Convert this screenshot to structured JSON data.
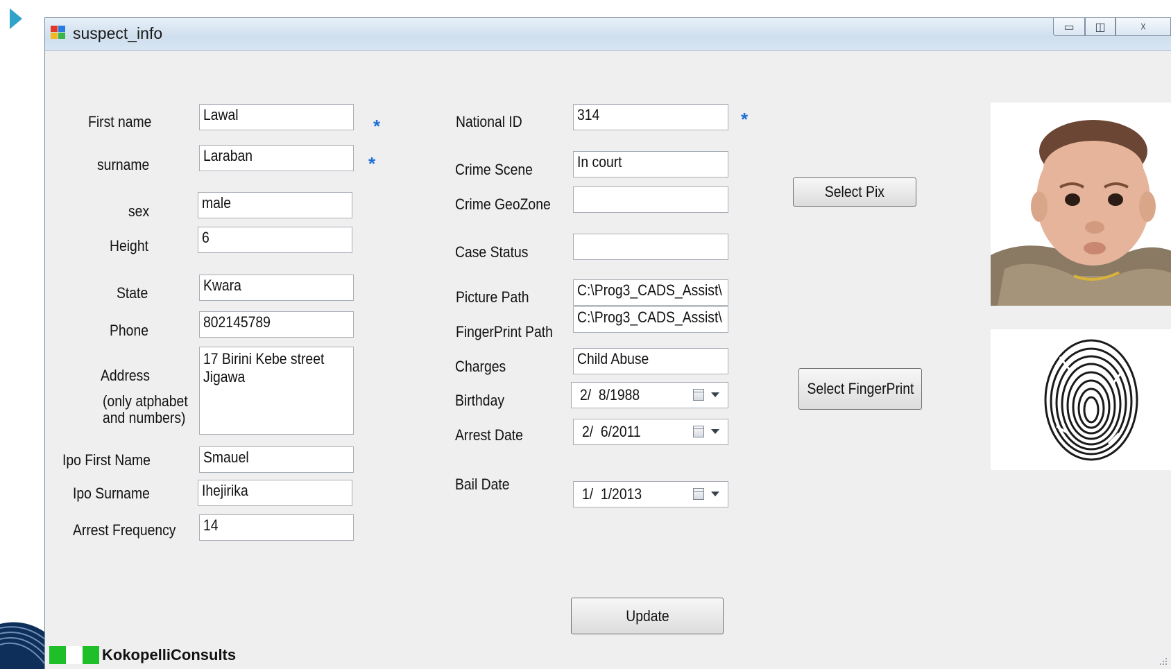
{
  "window": {
    "title": "suspect_info",
    "controls": {
      "minimize": "▭",
      "maximize": "◫",
      "close": "☓"
    }
  },
  "form": {
    "left": [
      {
        "label": "First name",
        "value": "Lawal"
      },
      {
        "label": "surname",
        "value": "Laraban"
      },
      {
        "label": "sex",
        "value": "male"
      },
      {
        "label": "Height",
        "value": "6"
      },
      {
        "label": "State",
        "value": "Kwara"
      },
      {
        "label": "Phone",
        "value": "802145789"
      },
      {
        "label": "Address",
        "hint_line1": "(only atphabet",
        "hint_line2": "and numbers)",
        "value": "17 Birini Kebe street Jigawa"
      },
      {
        "label": "Ipo First Name",
        "value": "Smauel"
      },
      {
        "label": "Ipo Surname",
        "value": "Ihejirika"
      },
      {
        "label": "Arrest Frequency",
        "value": "14"
      }
    ],
    "middle": [
      {
        "label": "National ID",
        "value": "314"
      },
      {
        "label": "Crime Scene",
        "value": "In court"
      },
      {
        "label": "Crime GeoZone",
        "value": ""
      },
      {
        "label": "Case Status",
        "value": ""
      },
      {
        "label": "Picture Path",
        "value": "C:\\Prog3_CADS_Assist\\"
      },
      {
        "label": "FingerPrint Path",
        "value": "C:\\Prog3_CADS_Assist\\"
      },
      {
        "label": "Charges",
        "value": "Child Abuse"
      },
      {
        "label": "Birthday",
        "value": "2/  8/1988"
      },
      {
        "label": "Arrest Date",
        "value": "2/  6/2011"
      },
      {
        "label": "Bail Date",
        "value": "1/  1/2013"
      }
    ],
    "required_marker": "*"
  },
  "buttons": {
    "select_pix": "Select Pix",
    "select_fingerprint": "Select FingerPrint",
    "update": "Update"
  },
  "images": {
    "photo": "suspect-photo",
    "fingerprint": "fingerprint-image"
  },
  "brand": {
    "name": "KokopelliConsults",
    "color": "#1fbf2a"
  },
  "colors": {
    "required_star": "#1f6fd6",
    "window_bg": "#efefef",
    "slide_arrow": "#2fa3c9"
  }
}
